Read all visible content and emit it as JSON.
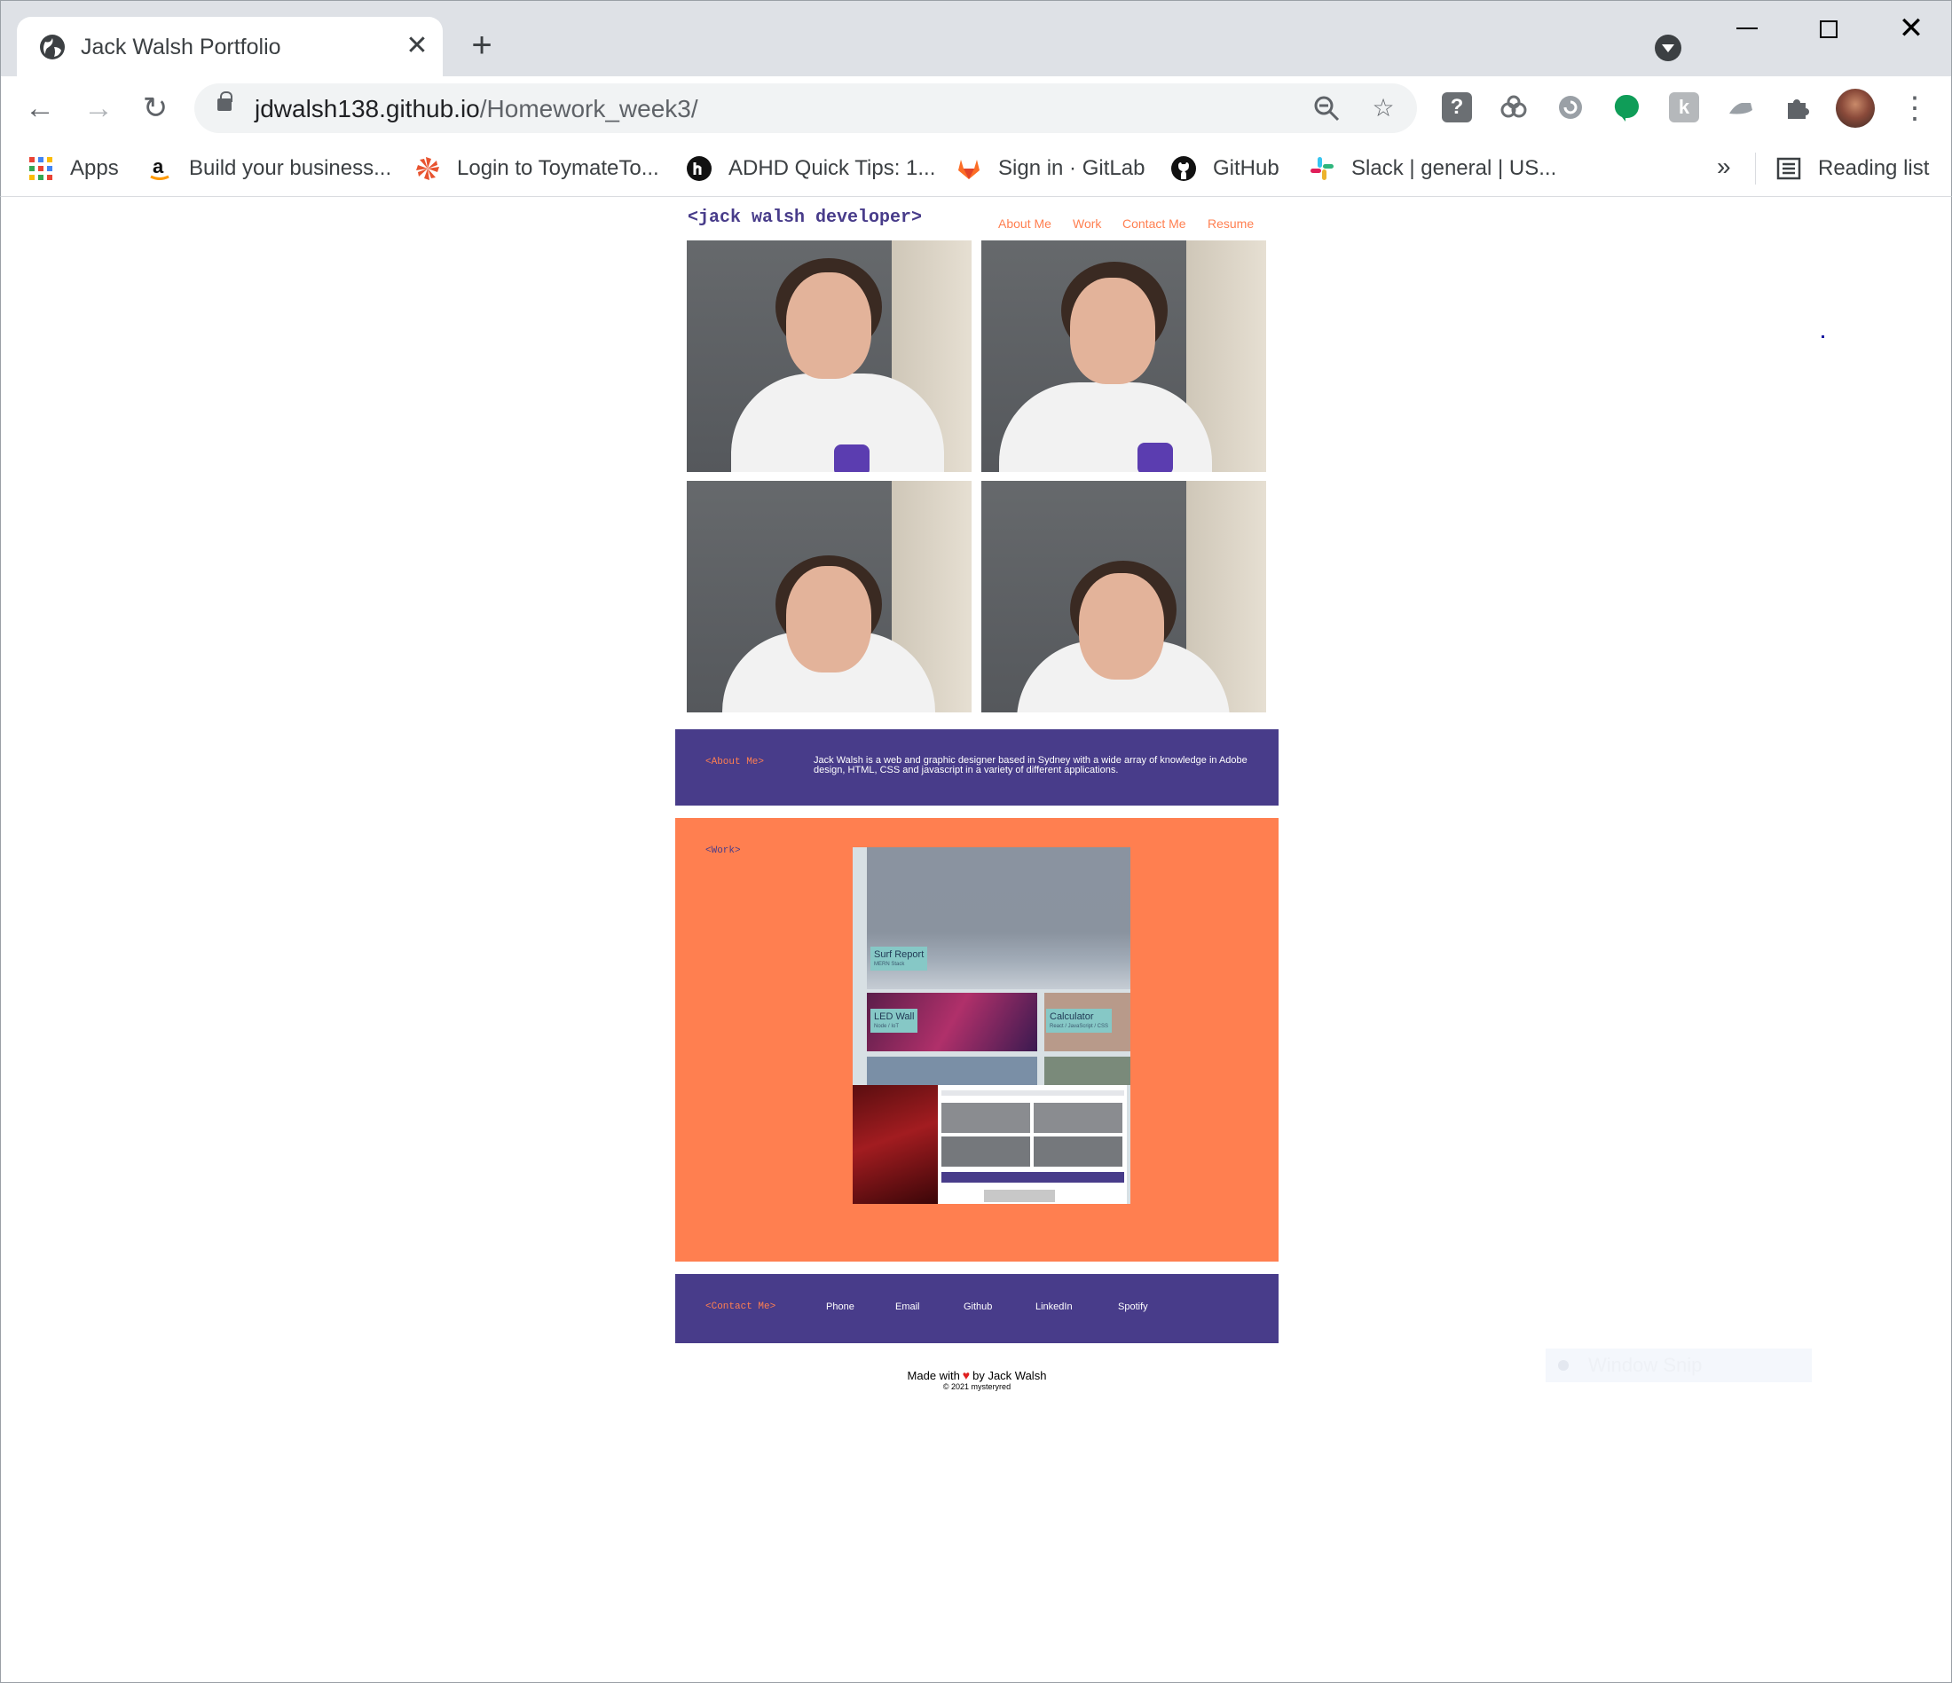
{
  "browser": {
    "tab_title": "Jack Walsh Portfolio",
    "new_tab_label": "+",
    "url_host": "jdwalsh138.github.io",
    "url_path": "/Homework_week3/"
  },
  "bookmarks": {
    "items": [
      {
        "label": "Apps",
        "icon": "apps-grid-icon"
      },
      {
        "label": "Build your business...",
        "icon": "amazon-icon"
      },
      {
        "label": "Login to ToymateTo...",
        "icon": "toymate-icon"
      },
      {
        "label": "ADHD Quick Tips: 1...",
        "icon": "medium-icon"
      },
      {
        "label": "Sign in · GitLab",
        "icon": "gitlab-icon"
      },
      {
        "label": "GitHub",
        "icon": "github-icon"
      },
      {
        "label": "Slack | general | US...",
        "icon": "slack-icon"
      }
    ],
    "more_label": "»",
    "reading_list_label": "Reading list"
  },
  "site": {
    "logo": "<jack walsh developer>",
    "nav": [
      "About Me",
      "Work",
      "Contact Me",
      "Resume"
    ],
    "about": {
      "title": "<About Me>",
      "text": "Jack Walsh is a web and graphic designer based in Sydney with a wide array of knowledge in Adobe design, HTML, CSS and javascript in a variety of different applications."
    },
    "work": {
      "title": "<Work>",
      "cards": [
        {
          "title": "Surf Report",
          "subtitle": "MERN Stack"
        },
        {
          "title": "LED Wall",
          "subtitle": "Node / IoT"
        },
        {
          "title": "Calculator",
          "subtitle": "React / JavaScript / CSS"
        }
      ]
    },
    "contact": {
      "title": "<Contact Me>",
      "links": [
        "Phone",
        "Email",
        "Github",
        "LinkedIn",
        "Spotify"
      ]
    },
    "footer": {
      "made_with": "Made with",
      "by": "by Jack Walsh",
      "copyright": "© 2021 mysteryred"
    }
  },
  "overlay": {
    "window_snip_label": "Window Snip"
  },
  "colors": {
    "brand_purple": "#483c8a",
    "brand_orange": "#ff7f50"
  }
}
